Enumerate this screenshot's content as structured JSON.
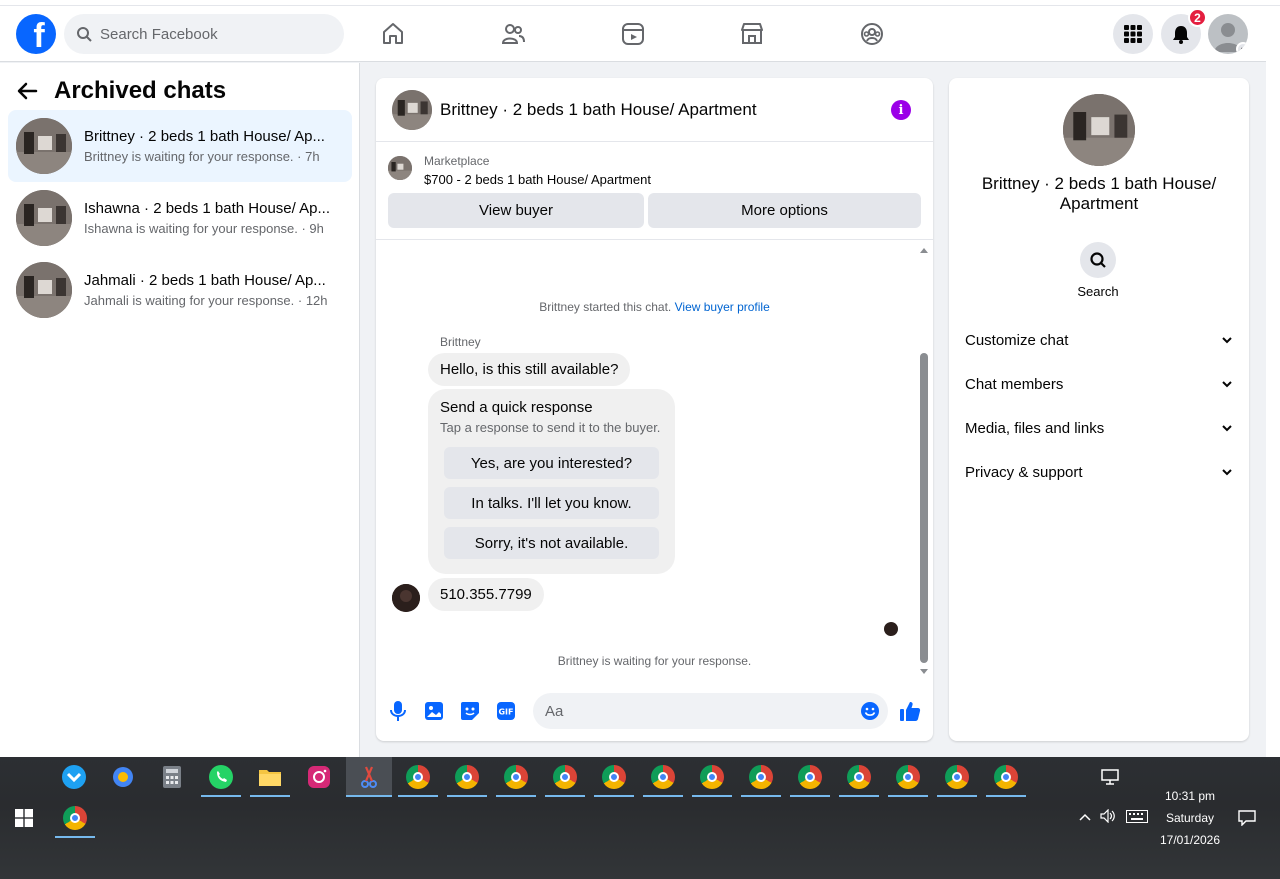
{
  "header": {
    "logo_letter": "f",
    "search_placeholder": "Search Facebook",
    "notifications_count": "2"
  },
  "sidebar": {
    "title": "Archived chats",
    "chats": [
      {
        "name": "Brittney · 2 beds 1 bath House/ Ap...",
        "status": "Brittney is waiting for your response. · 7h"
      },
      {
        "name": "Ishawna · 2 beds 1 bath House/ Ap...",
        "status": "Ishawna is waiting for your response. · 9h"
      },
      {
        "name": "Jahmali · 2 beds 1 bath House/ Ap...",
        "status": "Jahmali is waiting for your response. · 12h"
      }
    ]
  },
  "conversation": {
    "title": "Brittney · 2 beds 1 bath House/ Apartment",
    "marketplace_label": "Marketplace",
    "listing": "$700 - 2 beds 1 bath House/ Apartment",
    "view_buyer": "View buyer",
    "more_options": "More options",
    "started_text": "Brittney started this chat.",
    "view_profile": "View buyer profile",
    "sender": "Brittney",
    "message1": "Hello, is this still available?",
    "quick_title": "Send a quick response",
    "quick_sub": "Tap a response to send it to the buyer.",
    "quick_replies": [
      "Yes, are you interested?",
      "In talks. I'll let you know.",
      "Sorry, it's not available."
    ],
    "message2": "510.355.7799",
    "waiting": "Brittney is waiting for your response.",
    "composer_placeholder": "Aa"
  },
  "details": {
    "name": "Brittney · 2 beds 1 bath House/ Apartment",
    "search_label": "Search",
    "sections": [
      "Customize chat",
      "Chat members",
      "Media, files and links",
      "Privacy & support"
    ]
  },
  "taskbar": {
    "time": "10:31 pm",
    "day": "Saturday",
    "date": "17/01/2026"
  },
  "colors": {
    "brand": "#0866ff",
    "link": "#0064d1",
    "badge": "#e41e3f",
    "info": "#9b00e8"
  }
}
